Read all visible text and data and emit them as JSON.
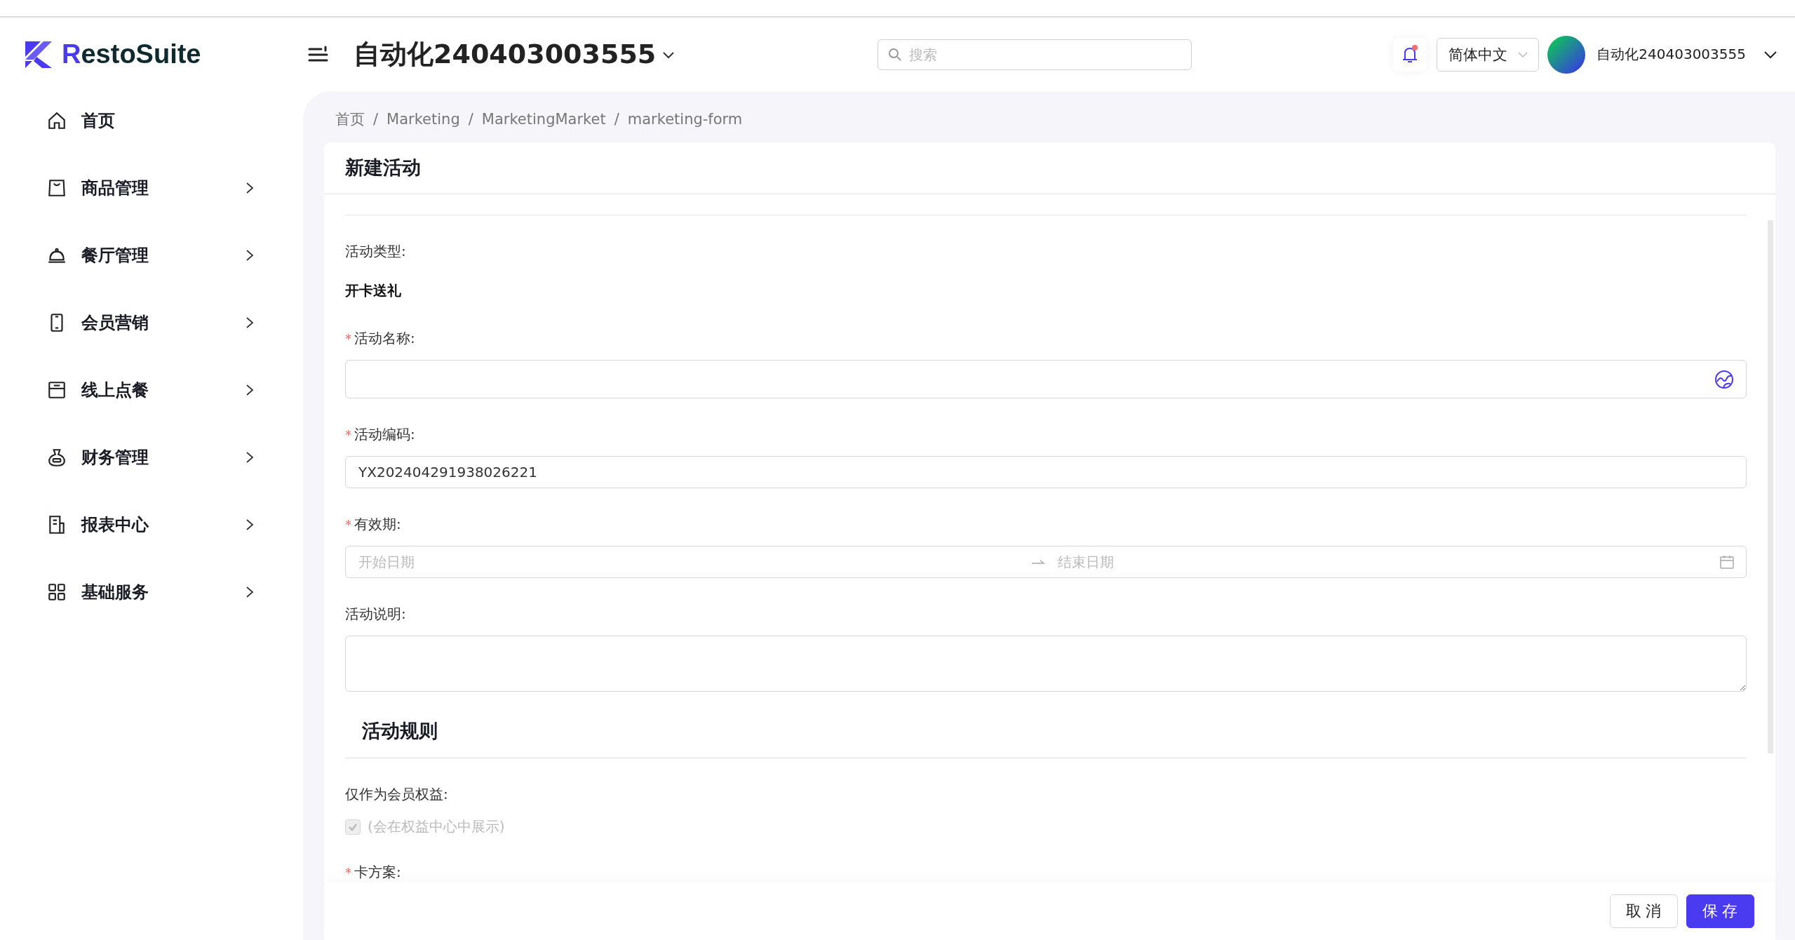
{
  "logo": "RestoSuite",
  "header": {
    "store_name": "自动化240403003555",
    "search": {
      "placeholder": "搜索"
    },
    "notification": {
      "unread": true
    },
    "language": "简体中文",
    "user_name": "自动化240403003555"
  },
  "sidebar": {
    "items": [
      {
        "label": "首页",
        "expandable": false
      },
      {
        "label": "商品管理",
        "expandable": true
      },
      {
        "label": "餐厅管理",
        "expandable": true
      },
      {
        "label": "会员营销",
        "expandable": true
      },
      {
        "label": "线上点餐",
        "expandable": true
      },
      {
        "label": "财务管理",
        "expandable": true
      },
      {
        "label": "报表中心",
        "expandable": true
      },
      {
        "label": "基础服务",
        "expandable": true
      }
    ]
  },
  "breadcrumb": {
    "separator": "/",
    "items": [
      "首页",
      "Marketing",
      "MarketingMarket",
      "marketing-form"
    ]
  },
  "form": {
    "title": "新建活动",
    "required_mark": "*",
    "fields": [
      {
        "kind": "static",
        "label": "活动类型:",
        "value": "开卡送礼"
      },
      {
        "kind": "text",
        "label": "活动名称:",
        "required": true,
        "translate": true
      },
      {
        "kind": "text",
        "label": "活动编码:",
        "required": true,
        "value": "YX202404291938026221"
      },
      {
        "kind": "daterange",
        "label": "有效期:",
        "required": true,
        "start_placeholder": "开始日期",
        "end_placeholder": "结束日期"
      },
      {
        "kind": "textarea",
        "label": "活动说明:",
        "required": false
      },
      {
        "kind": "section",
        "title": "活动规则"
      },
      {
        "kind": "checkbox",
        "label": "仅作为会员权益:",
        "text": "(会在权益中心中展示)",
        "checked": true,
        "disabled": true
      },
      {
        "kind": "label",
        "label": "卡方案:",
        "required": true
      }
    ]
  },
  "buttons": [
    {
      "label": "取消",
      "kind": "default"
    },
    {
      "label": "保存",
      "kind": "primary"
    }
  ]
}
